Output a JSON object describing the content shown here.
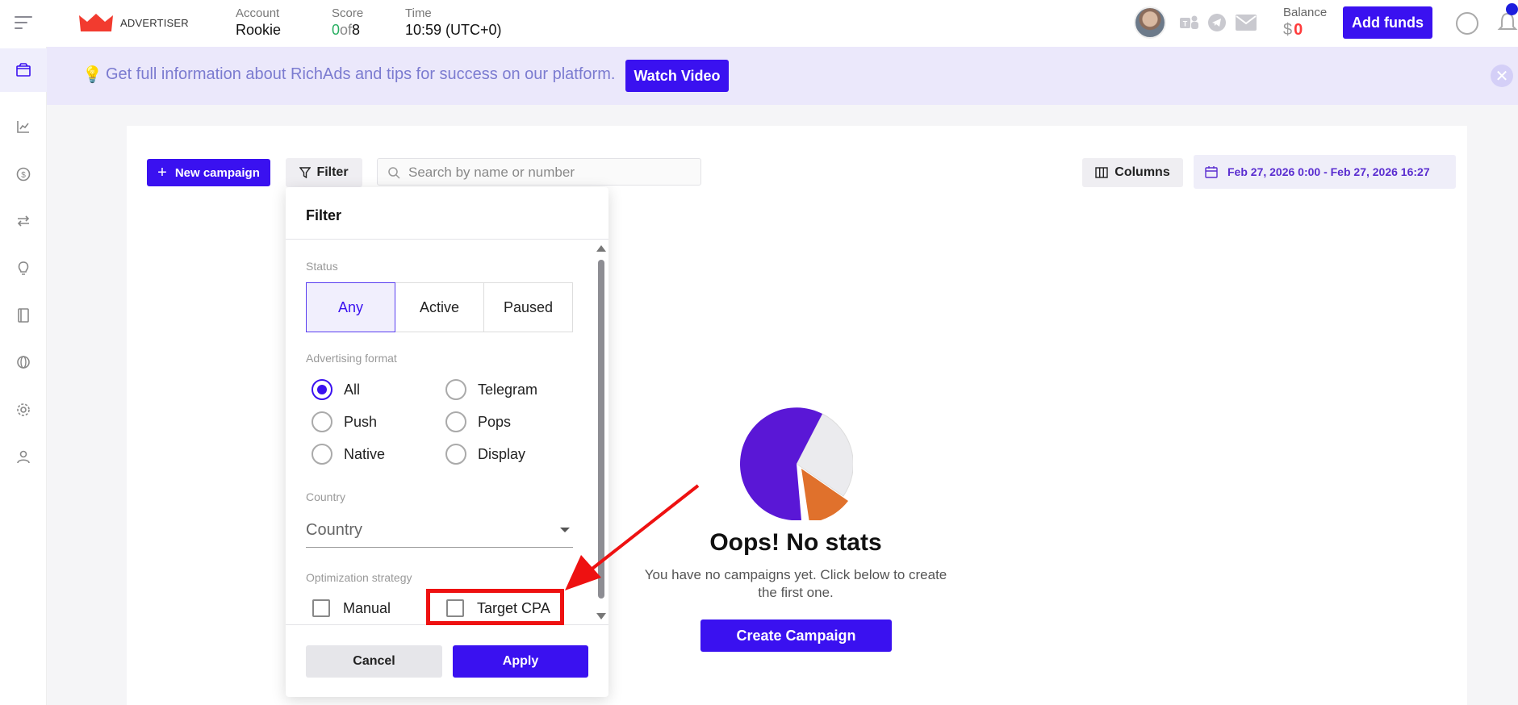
{
  "header": {
    "brand": "ADVERTISER",
    "account_label": "Account",
    "account_value": "Rookie",
    "score_label": "Score",
    "score_current": "0",
    "score_of": "of",
    "score_total": "8",
    "time_label": "Time",
    "time_value": "10:59 (UTC+0)",
    "balance_label": "Balance",
    "balance_currency": "$",
    "balance_value": "0",
    "add_funds_label": "Add funds"
  },
  "banner": {
    "text": "Get full information about RichAds and tips for success on our platform.",
    "button_label": "Watch Video",
    "close_glyph": "✕"
  },
  "sidebar": {
    "items": [
      {
        "icon": "campaigns-icon",
        "active": true
      },
      {
        "icon": "stats-chart-icon",
        "active": false
      },
      {
        "icon": "dollar-icon",
        "active": false
      },
      {
        "icon": "transfer-icon",
        "active": false
      },
      {
        "icon": "lightbulb-icon",
        "active": false
      },
      {
        "icon": "book-icon",
        "active": false
      },
      {
        "icon": "globe-icon",
        "active": false
      },
      {
        "icon": "gear-icon",
        "active": false
      },
      {
        "icon": "profile-icon",
        "active": false
      }
    ]
  },
  "toolbar": {
    "new_campaign_plus": "+",
    "new_campaign_label": "New campaign",
    "filter_label": "Filter",
    "search_placeholder": "Search by name or number",
    "columns_label": "Columns",
    "date_range": "Feb 27, 2026 0:00 - Feb 27, 2026 16:27"
  },
  "filter_panel": {
    "title": "Filter",
    "status_label": "Status",
    "status_options": [
      "Any",
      "Active",
      "Paused"
    ],
    "status_selected": "Any",
    "format_label": "Advertising format",
    "format_options": [
      "All",
      "Telegram",
      "Push",
      "Pops",
      "Native",
      "Display"
    ],
    "format_selected": "All",
    "country_label": "Country",
    "country_placeholder": "Country",
    "optimization_label": "Optimization strategy",
    "optimization_options": [
      "Manual",
      "Target CPA"
    ],
    "cancel_label": "Cancel",
    "apply_label": "Apply"
  },
  "empty_state": {
    "title": "Oops! No stats",
    "subtitle": "You have no campaigns yet. Click below to create the first one.",
    "button_label": "Create Campaign"
  },
  "colors": {
    "accent": "#3a11f0",
    "banner_bg": "#ebe8fb",
    "annotation": "#ee1111",
    "pie_purple": "#5a17d6",
    "pie_orange": "#e0712c",
    "pie_light": "#ebebee"
  }
}
